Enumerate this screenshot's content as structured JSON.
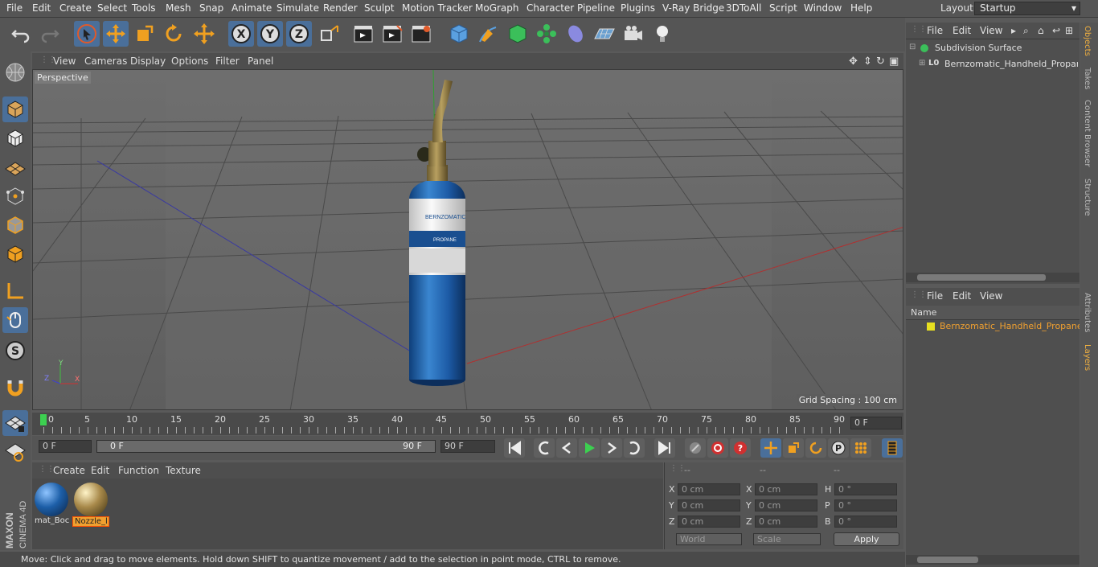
{
  "menu": [
    "File",
    "Edit",
    "Create",
    "Select",
    "Tools",
    "Mesh",
    "Snap",
    "Animate",
    "Simulate",
    "Render",
    "Sculpt",
    "Motion Tracker",
    "MoGraph",
    "Character",
    "Pipeline",
    "Plugins",
    "V-Ray Bridge",
    "3DToAll",
    "Script",
    "Window",
    "Help"
  ],
  "layout": {
    "label": "Layout:",
    "value": "Startup"
  },
  "viewport": {
    "menu": [
      "View",
      "Cameras",
      "Display",
      "Options",
      "Filter",
      "Panel"
    ],
    "label": "Perspective",
    "grid_spacing": "Grid Spacing : 100 cm",
    "axis": {
      "y": "Y",
      "z": "Z",
      "x": "X"
    }
  },
  "timeline": {
    "ticks": [
      "0",
      "5",
      "10",
      "15",
      "20",
      "25",
      "30",
      "35",
      "40",
      "45",
      "50",
      "55",
      "60",
      "65",
      "70",
      "75",
      "80",
      "85",
      "90"
    ],
    "current_frame": "0 F",
    "start_field": "0 F",
    "range_start": "0 F",
    "range_end": "90 F",
    "end_field": "90 F"
  },
  "material_manager": {
    "menu": [
      "Create",
      "Edit",
      "Function",
      "Texture"
    ],
    "materials": [
      {
        "label": "mat_Boc",
        "color": "#1d5fa8",
        "selected": false
      },
      {
        "label": "Nozzle_l",
        "color": "#a8894a",
        "selected": true
      }
    ]
  },
  "attributes": {
    "headers": [
      "--",
      "--",
      "--"
    ],
    "rows": [
      {
        "a": "X",
        "av": "0 cm",
        "b": "X",
        "bv": "0 cm",
        "c": "H",
        "cv": "0 °"
      },
      {
        "a": "Y",
        "av": "0 cm",
        "b": "Y",
        "bv": "0 cm",
        "c": "P",
        "cv": "0 °"
      },
      {
        "a": "Z",
        "av": "0 cm",
        "b": "Z",
        "bv": "0 cm",
        "c": "B",
        "cv": "0 °"
      }
    ],
    "world": "World",
    "scale": "Scale",
    "apply": "Apply"
  },
  "status": "Move: Click and drag to move elements. Hold down SHIFT to quantize movement / add to the selection in point mode, CTRL to remove.",
  "object_manager": {
    "menu": [
      "File",
      "Edit",
      "View"
    ],
    "items": [
      {
        "label": "Subdivision Surface"
      },
      {
        "label": "Bernzomatic_Handheld_Propane_"
      }
    ]
  },
  "layer_manager": {
    "menu": [
      "File",
      "Edit",
      "View"
    ],
    "column": "Name",
    "items": [
      {
        "label": "Bernzomatic_Handheld_Propane_"
      }
    ]
  },
  "side_tabs": [
    "Objects",
    "Takes",
    "Content Browser",
    "Structure",
    "Attributes",
    "Layers"
  ],
  "brand": {
    "maxon": "MAXON",
    "cinema": "CINEMA 4D"
  },
  "colors": {
    "selection_blue": "#4a6f9a",
    "highlight_orange": "#f0a030",
    "layer_yellow": "#e8e020"
  }
}
